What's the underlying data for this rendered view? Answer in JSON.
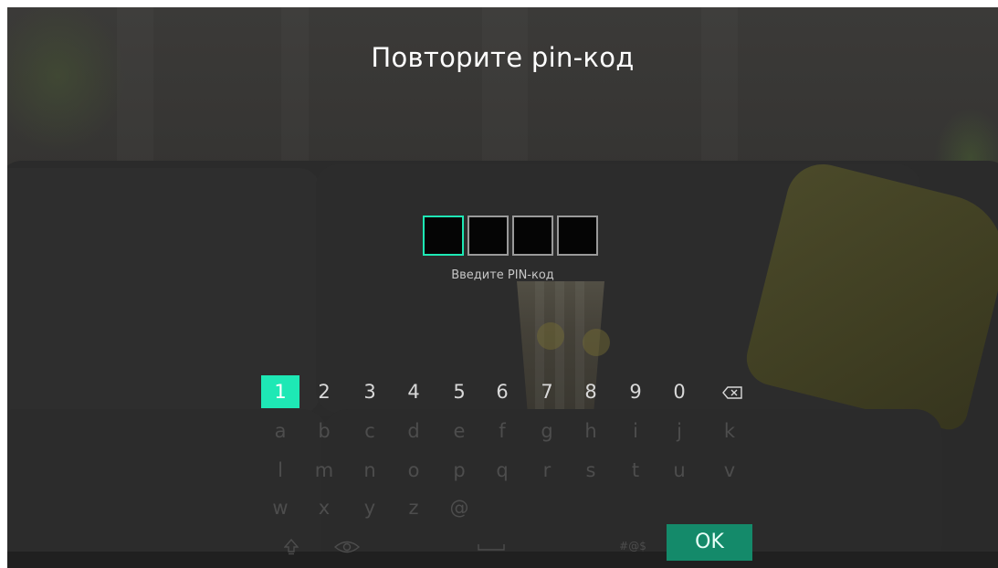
{
  "screen": {
    "title": "Повторите pin-код",
    "pin": {
      "length": 4,
      "active_index": 0,
      "hint": "Введите PIN-код"
    }
  },
  "keyboard": {
    "digits": [
      "1",
      "2",
      "3",
      "4",
      "5",
      "6",
      "7",
      "8",
      "9",
      "0"
    ],
    "selected_key": "1",
    "backspace_icon": "backspace-icon",
    "row2": [
      "a",
      "b",
      "c",
      "d",
      "e",
      "f",
      "g",
      "h",
      "i",
      "j",
      "k"
    ],
    "row3": [
      "l",
      "m",
      "n",
      "o",
      "p",
      "q",
      "r",
      "s",
      "t",
      "u",
      "v"
    ],
    "row4": [
      "w",
      "x",
      "y",
      "z",
      "@"
    ],
    "bottom": {
      "shift_icon": "shift-icon",
      "show_password_icon": "eye-icon",
      "space_icon": "space-bar-icon",
      "symbols_label": "#@$",
      "ok_label": "OK"
    }
  },
  "colors": {
    "accent": "#1ee8b5",
    "ok_button": "#148a6a",
    "pin_box_border": "#9a9a9a",
    "text": "#ffffff"
  }
}
